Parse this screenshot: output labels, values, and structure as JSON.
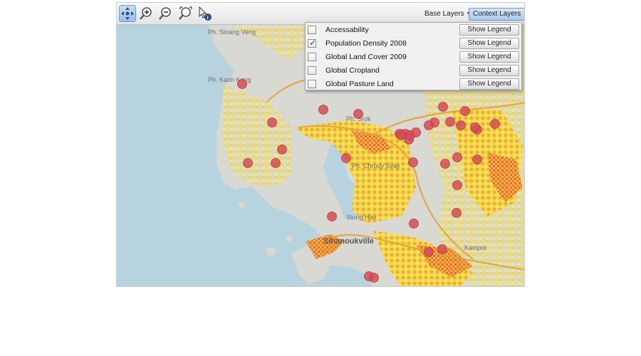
{
  "toolbar": {
    "tools": [
      {
        "icon": "pan-icon",
        "active": true
      },
      {
        "icon": "zoom-in-icon",
        "active": false
      },
      {
        "icon": "zoom-out-icon",
        "active": false
      },
      {
        "icon": "zoom-extent-icon",
        "active": false
      },
      {
        "icon": "identify-icon",
        "active": false
      }
    ],
    "base_layers_label": "Base Layers",
    "context_layers_label": "Context Layers"
  },
  "layer_panel": {
    "layers": [
      {
        "name": "Accessability",
        "checked": false,
        "legend_label": "Show Legend"
      },
      {
        "name": "Population Density 2008",
        "checked": true,
        "legend_label": "Show Legend"
      },
      {
        "name": "Global Land Cover 2009",
        "checked": false,
        "legend_label": "Show Legend"
      },
      {
        "name": "Global Cropland",
        "checked": false,
        "legend_label": "Show Legend"
      },
      {
        "name": "Global Pasture Land",
        "checked": false,
        "legend_label": "Show Legend"
      }
    ]
  },
  "map": {
    "place_labels": [
      "Ph. Sloang Veng",
      "Ph. Kaoh Kong",
      "Ph. Srok",
      "Ph. Chrouy Svay",
      "Stung Hav",
      "Sihanoukville",
      "Kampot"
    ],
    "colors": {
      "sea": "#b7d3df",
      "land": "#d9d9d4",
      "density_low": "#f4e14a",
      "density_high": "#e8542b",
      "marker": "#d64b55"
    },
    "marker_count": 35
  }
}
